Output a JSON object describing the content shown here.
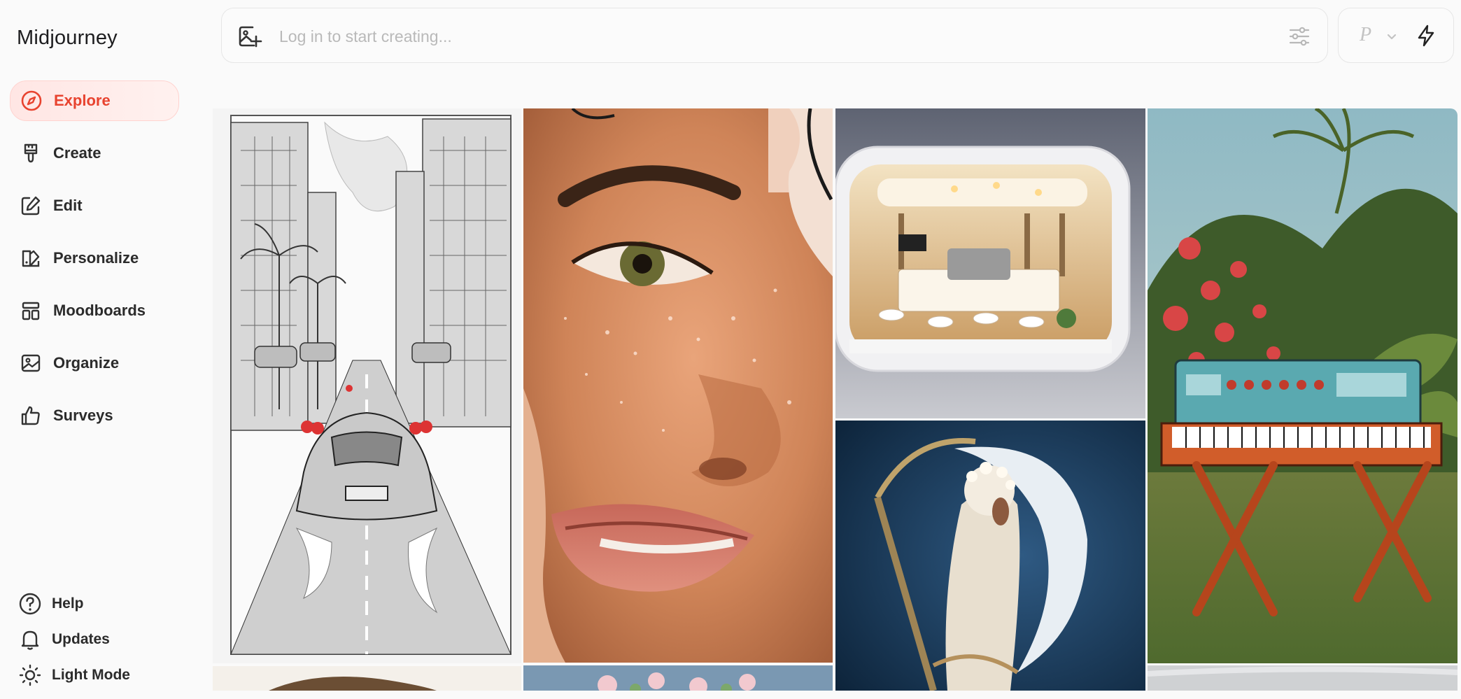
{
  "app": {
    "brand": "Midjourney"
  },
  "sidebar": {
    "items": [
      {
        "label": "Explore",
        "icon": "compass-icon",
        "active": true
      },
      {
        "label": "Create",
        "icon": "paintbrush-icon",
        "active": false
      },
      {
        "label": "Edit",
        "icon": "edit-icon",
        "active": false
      },
      {
        "label": "Personalize",
        "icon": "personalize-icon",
        "active": false
      },
      {
        "label": "Moodboards",
        "icon": "moodboard-icon",
        "active": false
      },
      {
        "label": "Organize",
        "icon": "image-icon",
        "active": false
      },
      {
        "label": "Surveys",
        "icon": "thumbs-up-icon",
        "active": false
      }
    ],
    "bottom": [
      {
        "label": "Help",
        "icon": "help-icon"
      },
      {
        "label": "Updates",
        "icon": "bell-icon"
      },
      {
        "label": "Light Mode",
        "icon": "sun-icon"
      }
    ]
  },
  "prompt": {
    "placeholder": "Log in to start creating...",
    "mode_label": "P"
  },
  "colors": {
    "accent": "#e8432f",
    "accent_bg": "#ffe6e4"
  },
  "gallery": {
    "images": [
      {
        "name": "sketch-car-street-image"
      },
      {
        "name": "wet-face-closeup-image"
      },
      {
        "name": "miniature-cafe-capsule-image"
      },
      {
        "name": "moon-goddess-image"
      },
      {
        "name": "retro-synth-garden-image"
      },
      {
        "name": "partial-bottom-image-1"
      },
      {
        "name": "partial-bottom-image-2"
      },
      {
        "name": "partial-bottom-image-3"
      }
    ]
  }
}
